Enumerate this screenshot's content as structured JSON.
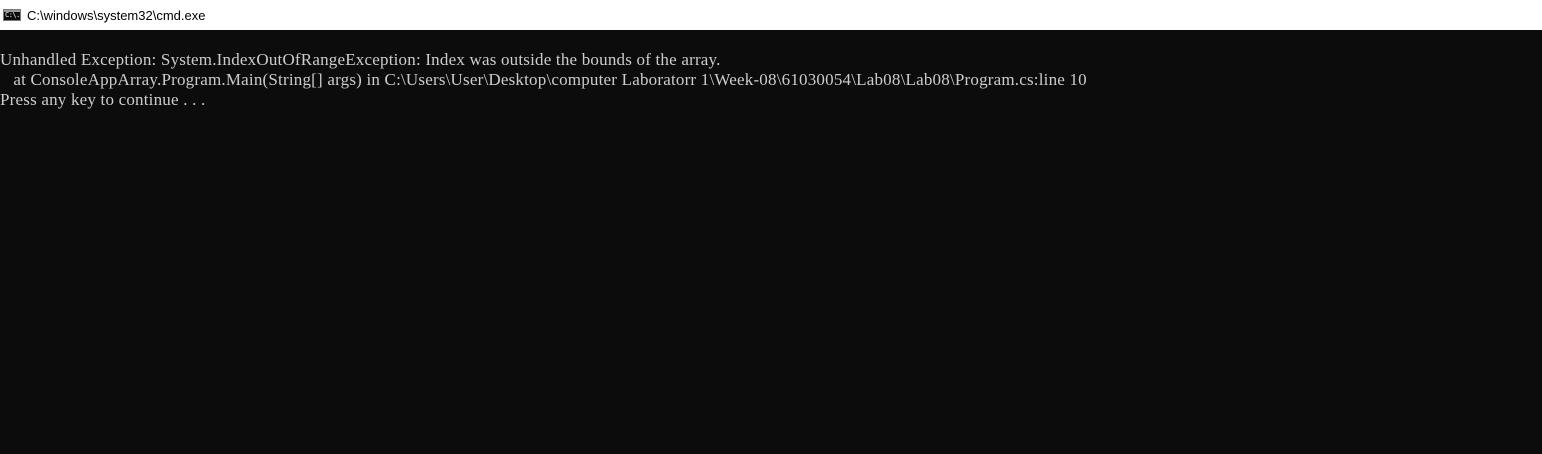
{
  "window": {
    "title": "C:\\windows\\system32\\cmd.exe",
    "icon": "cmd-icon",
    "icon_glyph": "C:\\."
  },
  "console": {
    "lines": [
      "Unhandled Exception: System.IndexOutOfRangeException: Index was outside the bounds of the array.",
      "   at ConsoleAppArray.Program.Main(String[] args) in C:\\Users\\User\\Desktop\\computer Laboratorr 1\\Week-08\\61030054\\Lab08\\Lab08\\Program.cs:line 10",
      "Press any key to continue . . ."
    ]
  },
  "colors": {
    "console_background": "#0c0c0c",
    "console_text": "#cccccc",
    "titlebar_background": "#ffffff"
  }
}
